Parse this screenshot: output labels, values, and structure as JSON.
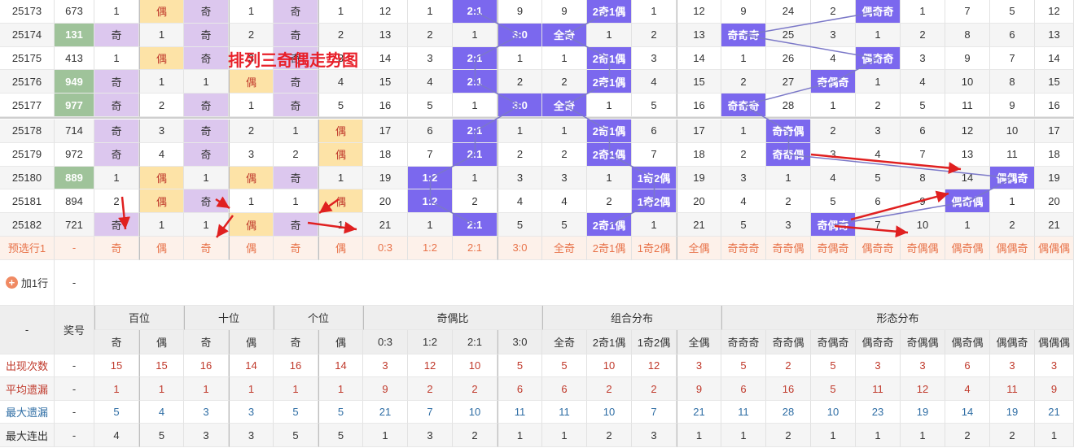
{
  "title": "排列三奇偶走势图",
  "columns": [
    {
      "group": "奖号",
      "name": "奖号"
    },
    {
      "group": "百位",
      "name": "奇"
    },
    {
      "group": "百位",
      "name": "偶"
    },
    {
      "group": "十位",
      "name": "奇"
    },
    {
      "group": "十位",
      "name": "偶"
    },
    {
      "group": "个位",
      "name": "奇"
    },
    {
      "group": "个位",
      "name": "偶"
    },
    {
      "group": "奇偶比",
      "name": "0:3"
    },
    {
      "group": "奇偶比",
      "name": "1:2"
    },
    {
      "group": "奇偶比",
      "name": "2:1"
    },
    {
      "group": "奇偶比",
      "name": "3:0"
    },
    {
      "group": "组合分布",
      "name": "全奇"
    },
    {
      "group": "组合分布",
      "name": "2奇1偶"
    },
    {
      "group": "组合分布",
      "name": "1奇2偶"
    },
    {
      "group": "组合分布",
      "name": "全偶"
    },
    {
      "group": "形态分布",
      "name": "奇奇奇"
    },
    {
      "group": "形态分布",
      "name": "奇奇偶"
    },
    {
      "group": "形态分布",
      "name": "奇偶奇"
    },
    {
      "group": "形态分布",
      "name": "偶奇奇"
    },
    {
      "group": "形态分布",
      "name": "奇偶偶"
    },
    {
      "group": "形态分布",
      "name": "偶奇偶"
    },
    {
      "group": "形态分布",
      "name": "偶偶奇"
    },
    {
      "group": "形态分布",
      "name": "偶偶偶"
    }
  ],
  "groups": [
    {
      "label": "奖号",
      "span": 1
    },
    {
      "label": "百位",
      "span": 2
    },
    {
      "label": "十位",
      "span": 2
    },
    {
      "label": "个位",
      "span": 2
    },
    {
      "label": "奇偶比",
      "span": 4
    },
    {
      "label": "组合分布",
      "span": 4
    },
    {
      "label": "形态分布",
      "span": 8
    }
  ],
  "draws": [
    {
      "issue": "25173",
      "number": "673",
      "green": false,
      "cells": [
        "1",
        "偶",
        "奇",
        "1",
        "奇",
        "1",
        "12",
        "1",
        "2:1",
        "9",
        "9",
        "2奇1偶",
        "1",
        "12",
        "9",
        "24",
        "2",
        "偶奇奇",
        "1",
        "7",
        "5",
        "12"
      ]
    },
    {
      "issue": "25174",
      "number": "131",
      "green": true,
      "cells": [
        "奇",
        "1",
        "奇",
        "2",
        "奇",
        "2",
        "13",
        "2",
        "1",
        "3:0",
        "全奇",
        "1",
        "2",
        "13",
        "奇奇奇",
        "25",
        "3",
        "1",
        "2",
        "8",
        "6",
        "13"
      ]
    },
    {
      "issue": "25175",
      "number": "413",
      "green": false,
      "cells": [
        "1",
        "偶",
        "奇",
        "3",
        "奇",
        "3",
        "14",
        "3",
        "2:1",
        "1",
        "1",
        "2奇1偶",
        "3",
        "14",
        "1",
        "26",
        "4",
        "偶奇奇",
        "3",
        "9",
        "7",
        "14"
      ]
    },
    {
      "issue": "25176",
      "number": "949",
      "green": true,
      "cells": [
        "奇",
        "1",
        "1",
        "偶",
        "奇",
        "4",
        "15",
        "4",
        "2:1",
        "2",
        "2",
        "2奇1偶",
        "4",
        "15",
        "2",
        "27",
        "奇偶奇",
        "1",
        "4",
        "10",
        "8",
        "15"
      ]
    },
    {
      "issue": "25177",
      "number": "977",
      "green": true,
      "cells": [
        "奇",
        "2",
        "奇",
        "1",
        "奇",
        "5",
        "16",
        "5",
        "1",
        "3:0",
        "全奇",
        "1",
        "5",
        "16",
        "奇奇奇",
        "28",
        "1",
        "2",
        "5",
        "11",
        "9",
        "16"
      ]
    },
    {
      "issue": "25178",
      "number": "714",
      "green": false,
      "cells": [
        "奇",
        "3",
        "奇",
        "2",
        "1",
        "偶",
        "17",
        "6",
        "2:1",
        "1",
        "1",
        "2奇1偶",
        "6",
        "17",
        "1",
        "奇奇偶",
        "2",
        "3",
        "6",
        "12",
        "10",
        "17"
      ]
    },
    {
      "issue": "25179",
      "number": "972",
      "green": false,
      "cells": [
        "奇",
        "4",
        "奇",
        "3",
        "2",
        "偶",
        "18",
        "7",
        "2:1",
        "2",
        "2",
        "2奇1偶",
        "7",
        "18",
        "2",
        "奇奇偶",
        "3",
        "4",
        "7",
        "13",
        "11",
        "18"
      ]
    },
    {
      "issue": "25180",
      "number": "889",
      "green": true,
      "cells": [
        "1",
        "偶",
        "1",
        "偶",
        "奇",
        "1",
        "19",
        "1:2",
        "1",
        "3",
        "3",
        "1",
        "1奇2偶",
        "19",
        "3",
        "1",
        "4",
        "5",
        "8",
        "14",
        "偶偶奇",
        "19"
      ]
    },
    {
      "issue": "25181",
      "number": "894",
      "green": false,
      "cells": [
        "2",
        "偶",
        "奇",
        "1",
        "1",
        "偶",
        "20",
        "1:2",
        "2",
        "4",
        "4",
        "2",
        "1奇2偶",
        "20",
        "4",
        "2",
        "5",
        "6",
        "9",
        "偶奇偶",
        "1",
        "20"
      ]
    },
    {
      "issue": "25182",
      "number": "721",
      "green": false,
      "cells": [
        "奇",
        "1",
        "1",
        "偶",
        "奇",
        "1",
        "21",
        "1",
        "2:1",
        "5",
        "5",
        "2奇1偶",
        "1",
        "21",
        "5",
        "3",
        "奇偶奇",
        "7",
        "10",
        "1",
        "2",
        "21"
      ]
    }
  ],
  "preselect": {
    "label": "预选行1",
    "number": "-",
    "cells": [
      "奇",
      "偶",
      "奇",
      "偶",
      "奇",
      "偶",
      "0:3",
      "1:2",
      "2:1",
      "3:0",
      "全奇",
      "2奇1偶",
      "1奇2偶",
      "全偶",
      "奇奇奇",
      "奇奇偶",
      "奇偶奇",
      "偶奇奇",
      "奇偶偶",
      "偶奇偶",
      "偶偶奇",
      "偶偶偶"
    ]
  },
  "add_row": {
    "label": "加1行",
    "value": "-"
  },
  "stats_header": {
    "corner": "-",
    "number_label": "奖号"
  },
  "stats": [
    {
      "label": "出现次数",
      "number": "-",
      "color": "#c0392b",
      "values": [
        "15",
        "15",
        "16",
        "14",
        "16",
        "14",
        "3",
        "12",
        "10",
        "5",
        "5",
        "10",
        "12",
        "3",
        "5",
        "2",
        "5",
        "3",
        "3",
        "6",
        "3",
        "3"
      ]
    },
    {
      "label": "平均遗漏",
      "number": "-",
      "color": "#c0392b",
      "values": [
        "1",
        "1",
        "1",
        "1",
        "1",
        "1",
        "9",
        "2",
        "2",
        "6",
        "6",
        "2",
        "2",
        "9",
        "6",
        "16",
        "5",
        "11",
        "12",
        "4",
        "11",
        "9"
      ]
    },
    {
      "label": "最大遗漏",
      "number": "-",
      "color": "#2e6da4",
      "values": [
        "5",
        "4",
        "3",
        "3",
        "5",
        "5",
        "21",
        "7",
        "10",
        "11",
        "11",
        "10",
        "7",
        "21",
        "11",
        "28",
        "10",
        "23",
        "19",
        "14",
        "19",
        "21"
      ]
    },
    {
      "label": "最大连出",
      "number": "-",
      "color": "#333333",
      "values": [
        "4",
        "5",
        "3",
        "3",
        "5",
        "5",
        "1",
        "3",
        "2",
        "1",
        "1",
        "2",
        "3",
        "1",
        "1",
        "2",
        "1",
        "1",
        "1",
        "2",
        "2",
        "1"
      ]
    }
  ],
  "colors": {
    "odd": "#dcc7ee",
    "even": "#fde3a7",
    "hit": "#7b68ee",
    "green": "#9fc39a",
    "accent": "#e8202a",
    "arrow": "#e02020",
    "trendline": "#7b78c8"
  }
}
